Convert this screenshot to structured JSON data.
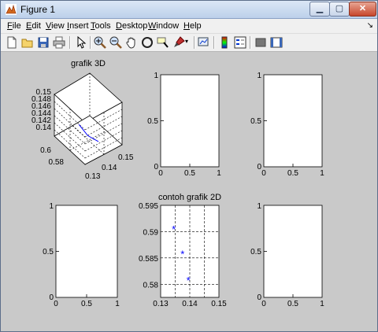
{
  "window": {
    "title": "Figure 1",
    "minimize": "▁",
    "maximize": "▢",
    "close": "✕"
  },
  "menu": [
    {
      "key": "F",
      "rest": "ile"
    },
    {
      "key": "E",
      "rest": "dit"
    },
    {
      "key": "V",
      "rest": "iew"
    },
    {
      "key": "I",
      "rest": "nsert"
    },
    {
      "key": "T",
      "rest": "ools"
    },
    {
      "key": "D",
      "rest": "esktop"
    },
    {
      "key": "W",
      "rest": "indow"
    },
    {
      "key": "H",
      "rest": "elp"
    }
  ],
  "toolbar": [
    "new-figure-icon",
    "open-file-icon",
    "save-icon",
    "print-icon",
    "select-arrow-icon",
    "zoom-in-icon",
    "zoom-out-icon",
    "pan-icon",
    "rotate-3d-icon",
    "data-cursor-icon",
    "brush-icon",
    "link-plot-icon",
    "colorbar-icon",
    "legend-icon",
    "hide-plot-tools-icon",
    "show-plot-tools-icon"
  ],
  "chart_data": [
    {
      "type": "line3d",
      "title": "grafik 3D",
      "x": [
        0.135,
        0.137,
        0.14
      ],
      "y": [
        0.59,
        0.585,
        0.58
      ],
      "z": [
        0.145,
        0.143,
        0.142
      ],
      "xticks": [
        "0.13",
        "0.14",
        "0.15"
      ],
      "yticks": [
        "0.58",
        "0.6"
      ],
      "zticks": [
        "0.15",
        "0.148",
        "0.146",
        "0.144",
        "0.142",
        "0.14"
      ],
      "grid": true,
      "color": "#0000ff"
    },
    {
      "type": "empty",
      "yticks": [
        "0",
        "0.5",
        "1"
      ],
      "xticks": [
        "0",
        "0.5",
        "1"
      ]
    },
    {
      "type": "empty",
      "yticks": [
        "0",
        "0.5",
        "1"
      ],
      "xticks": [
        "0",
        "0.5",
        "1"
      ]
    },
    {
      "type": "empty",
      "yticks": [
        "0",
        "0.5",
        "1"
      ],
      "xticks": [
        "0",
        "0.5",
        "1"
      ]
    },
    {
      "type": "scatter",
      "title": "contoh grafik 2D",
      "marker": "*",
      "color": "#0000ff",
      "x": [
        0.1345,
        0.1375,
        0.1395
      ],
      "y": [
        0.5905,
        0.5858,
        0.5808
      ],
      "xlim": [
        0.13,
        0.15
      ],
      "ylim": [
        0.5775,
        0.595
      ],
      "xticks": [
        0.13,
        0.135,
        0.14,
        0.145,
        0.15
      ],
      "xtick_labels": [
        "0.13",
        "",
        "0.14",
        "",
        "0.15"
      ],
      "yticks": [
        0.58,
        0.585,
        0.59,
        0.595
      ],
      "ytick_labels": [
        "0.58",
        "0.585",
        "0.59",
        "0.595"
      ],
      "grid": true
    },
    {
      "type": "empty",
      "yticks": [
        "0",
        "0.5",
        "1"
      ],
      "xticks": [
        "0",
        "0.5",
        "1"
      ]
    }
  ]
}
